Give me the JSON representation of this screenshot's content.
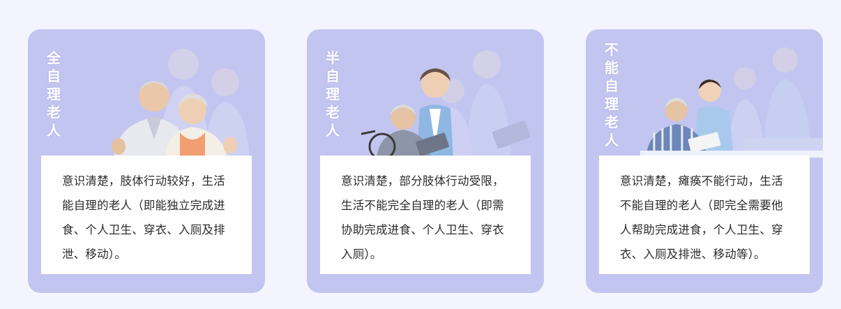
{
  "cards": [
    {
      "title_chars": [
        "全",
        "自",
        "理",
        "老",
        "人"
      ],
      "description": "意识清楚，肢体行动较好，生活能自理的老人（即能独立完成进食、个人卫生、穿衣、入厕及排泄、移动）。",
      "photo_icon": "elderly-couple-thumbs-up-photo"
    },
    {
      "title_chars": [
        "半",
        "自",
        "理",
        "老",
        "人"
      ],
      "description": "意识清楚，部分肢体行动受限，生活不能完全自理的老人（即需协助完成进食、个人卫生、穿衣入厕）。",
      "photo_icon": "wheelchair-elderly-couple-photo"
    },
    {
      "title_chars": [
        "不",
        "能",
        "自",
        "理",
        "老",
        "人"
      ],
      "description": "意识清楚，瘫痪不能行动，生活不能自理的老人（即完全需要他人帮助完成进食，个人卫生、穿衣、入厕及排泄、移动等）。",
      "photo_icon": "caregiver-with-elderly-photo"
    }
  ],
  "colors": {
    "card_bg": "#c2c5f0",
    "page_bg": "#f3f4fd",
    "text": "#2b2b2b"
  }
}
